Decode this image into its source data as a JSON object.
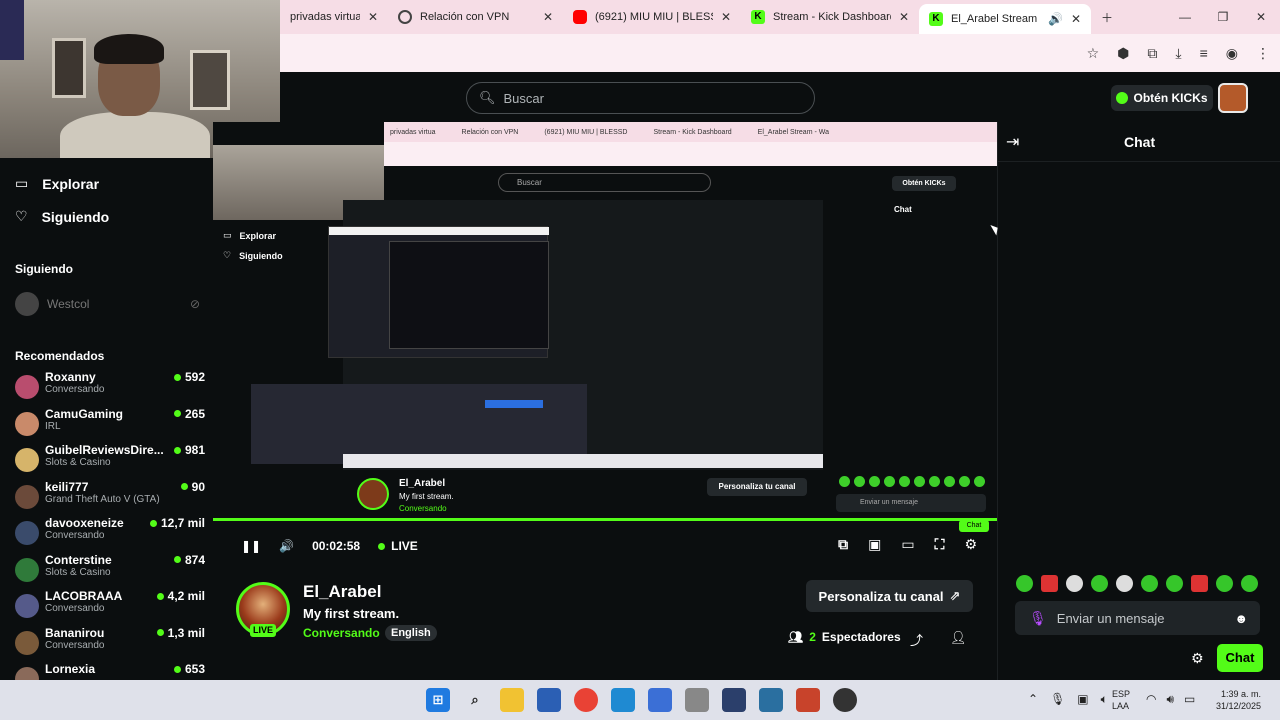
{
  "browser": {
    "tabs": [
      {
        "label": "privadas virtual",
        "icon": "none"
      },
      {
        "label": "Relación con VPN",
        "icon": "openai-icon"
      },
      {
        "label": "(6921) MIU MIU | BLESSD",
        "icon": "youtube-icon"
      },
      {
        "label": "Stream - Kick Dashboard",
        "icon": "kick-icon"
      },
      {
        "label": "El_Arabel Stream - Wa",
        "icon": "kick-icon"
      }
    ]
  },
  "header": {
    "search_placeholder": "Buscar",
    "kicks_label": "Obtén KICKs"
  },
  "sidebar": {
    "nav": [
      {
        "label": "Explorar"
      },
      {
        "label": "Siguiendo"
      }
    ],
    "following_title": "Siguiendo",
    "following": [
      {
        "name": "Westcol"
      }
    ],
    "recommended_title": "Recomendados",
    "recommended": [
      {
        "name": "Roxanny",
        "category": "Conversando",
        "viewers": "592",
        "color": "#b94d6e"
      },
      {
        "name": "CamuGaming",
        "category": "IRL",
        "viewers": "265",
        "color": "#c98a6a"
      },
      {
        "name": "GuibelReviewsDire...",
        "category": "Slots & Casino",
        "viewers": "981",
        "color": "#d6b46a"
      },
      {
        "name": "keili777",
        "category": "Grand Theft Auto V (GTA)",
        "viewers": "90",
        "color": "#6b4a3a"
      },
      {
        "name": "davooxeneize",
        "category": "Conversando",
        "viewers": "12,7 mil",
        "color": "#3a4b6b"
      },
      {
        "name": "Conterstine",
        "category": "Slots & Casino",
        "viewers": "874",
        "color": "#2f7a3a"
      },
      {
        "name": "LACOBRAAA",
        "category": "Conversando",
        "viewers": "4,2 mil",
        "color": "#555a8a"
      },
      {
        "name": "Bananirou",
        "category": "Conversando",
        "viewers": "1,3 mil",
        "color": "#7a5a3a"
      },
      {
        "name": "Lornexia",
        "category": "",
        "viewers": "653",
        "color": "#8a6a5a"
      }
    ]
  },
  "player": {
    "time": "00:02:58",
    "live_label": "LIVE",
    "inner_search": "Buscar",
    "inner_kicks": "Obtén KICKs",
    "inner_chat": "Chat",
    "inner_nav1": "Explorar",
    "inner_nav2": "Siguiendo",
    "inner_streamer": "El_Arabel",
    "inner_title": "My first stream.",
    "inner_category": "Conversando",
    "inner_personaliza": "Personaliza tu canal",
    "inner_msg": "Enviar un mensaje",
    "inner_chat_btn": "Chat",
    "inner_spectators": "2 Espectadores",
    "inner_tabs": [
      "privadas virtua",
      "Relación con VPN",
      "(6921) MIU MIU | BLESSD",
      "Stream - Kick Dashboard",
      "El_Arabel Stream - Wa"
    ]
  },
  "stream": {
    "streamer": "El_Arabel",
    "title": "My first stream.",
    "category": "Conversando",
    "tag": "English",
    "live_badge": "LIVE",
    "personaliza": "Personaliza tu canal",
    "viewer_count": "2",
    "viewer_label": "Espectadores"
  },
  "chat": {
    "title": "Chat",
    "placeholder": "Enviar un mensaje",
    "send_label": "Chat"
  },
  "taskbar": {
    "lang_top": "ESP",
    "lang_bottom": "LAA",
    "time": "1:39 a. m.",
    "date": "31/12/2025"
  },
  "colors": {
    "accent": "#53fc18",
    "background": "#0b0e0f"
  }
}
